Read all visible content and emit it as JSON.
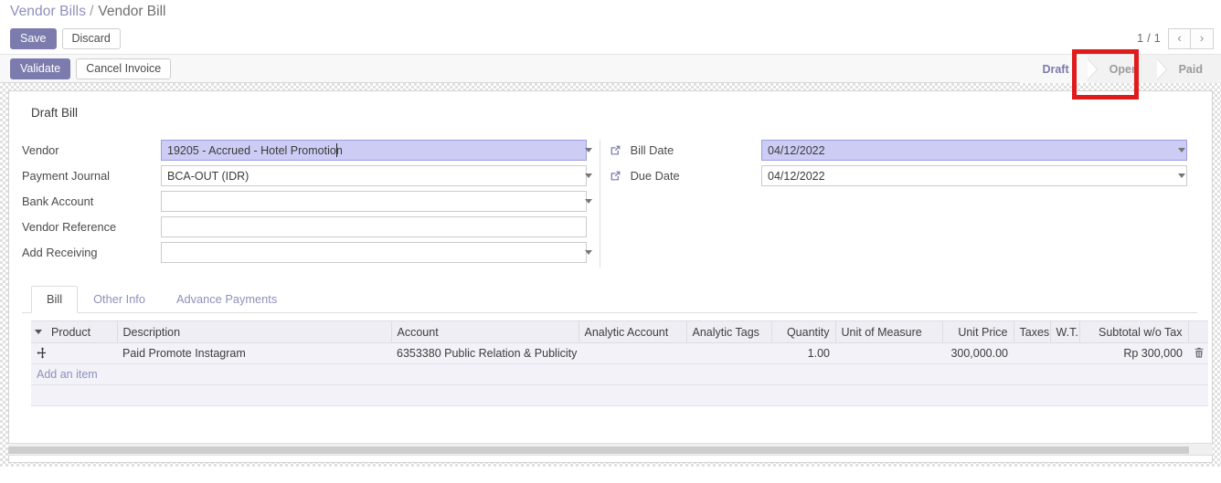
{
  "breadcrumb": {
    "parent": "Vendor Bills",
    "separator": "/",
    "current": "Vendor Bill"
  },
  "toolbar": {
    "save_label": "Save",
    "discard_label": "Discard"
  },
  "actions": {
    "validate_label": "Validate",
    "cancel_invoice_label": "Cancel Invoice"
  },
  "pager": {
    "count": "1 / 1",
    "prev_icon": "chevron-left-icon",
    "next_icon": "chevron-right-icon"
  },
  "statusbar": {
    "items": [
      {
        "label": "Draft",
        "active": true
      },
      {
        "label": "Open",
        "active": false
      },
      {
        "label": "Paid",
        "active": false
      }
    ],
    "highlight_color": "#e01b1b",
    "active_color": "#7c7bad"
  },
  "sheet": {
    "title": "Draft Bill",
    "left_fields": [
      {
        "label": "Vendor",
        "value": "19205 - Accrued - Hotel Promotion",
        "type": "select",
        "focused": true,
        "has_cursor": true
      },
      {
        "label": "Payment Journal",
        "value": "BCA-OUT (IDR)",
        "type": "select",
        "focused": false
      },
      {
        "label": "Bank Account",
        "value": "",
        "type": "select",
        "focused": false
      },
      {
        "label": "Vendor Reference",
        "value": "",
        "type": "text",
        "focused": false
      },
      {
        "label": "Add Receiving",
        "value": "",
        "type": "select",
        "focused": false
      }
    ],
    "right_fields": [
      {
        "label": "Bill Date",
        "value": "04/12/2022",
        "type": "select",
        "focused": true,
        "icon": "external-link-icon"
      },
      {
        "label": "Due Date",
        "value": "04/12/2022",
        "type": "select",
        "focused": false,
        "icon": "external-link-icon"
      }
    ]
  },
  "notebook": {
    "tabs": [
      {
        "label": "Bill",
        "active": true
      },
      {
        "label": "Other Info",
        "active": false
      },
      {
        "label": "Advance Payments",
        "active": false
      }
    ]
  },
  "lines": {
    "columns": [
      "Product",
      "Description",
      "Account",
      "Analytic Account",
      "Analytic Tags",
      "Quantity",
      "Unit of Measure",
      "Unit Price",
      "Taxes",
      "W.T.",
      "Subtotal w/o Tax"
    ],
    "rows": [
      {
        "product": "",
        "description": "Paid Promote Instagram",
        "account": "6353380 Public Relation & Publicity",
        "analytic_account": "",
        "analytic_tags": "",
        "quantity": "1.00",
        "unit_of_measure": "",
        "unit_price": "300,000.00",
        "taxes": "",
        "wt": "",
        "subtotal": "Rp 300,000"
      }
    ],
    "add_item_label": "Add an item",
    "row_handle_icon": "move-handle-icon",
    "row_delete_icon": "trash-icon"
  }
}
